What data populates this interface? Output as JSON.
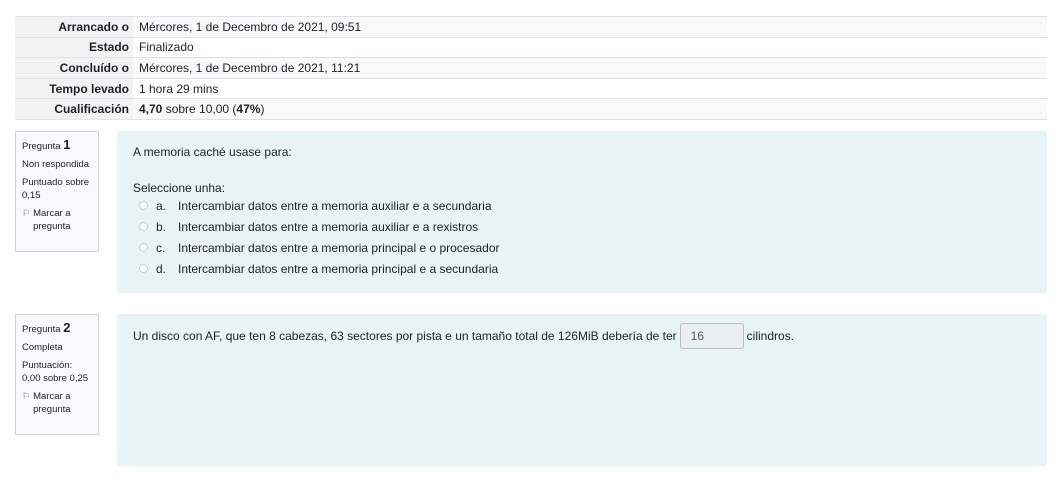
{
  "summary": {
    "rows": [
      {
        "label": "Arrancado o",
        "value": "Mércores, 1 de Decembro de 2021, 09:51"
      },
      {
        "label": "Estado",
        "value": "Finalizado"
      },
      {
        "label": "Concluído o",
        "value": "Mércores, 1 de Decembro de 2021, 11:21"
      },
      {
        "label": "Tempo levado",
        "value": "1 hora 29 mins"
      },
      {
        "label": "Cualificación",
        "grade": "4,70",
        "middle": " sobre 10,00 (",
        "percent": "47%",
        "end": ")"
      }
    ]
  },
  "q1": {
    "label": "Pregunta",
    "number": "1",
    "status": "Non respondida",
    "score": "Puntuado sobre 0,15",
    "flag_label": "Marcar a pregunta",
    "prompt": "A memoria caché usase para:",
    "select_label": "Seleccione unha:",
    "options": [
      {
        "letter": "a.",
        "text": "Intercambiar datos entre a memoria auxiliar e a secundaria"
      },
      {
        "letter": "b.",
        "text": "Intercambiar datos entre a memoria auxiliar e a rexistros"
      },
      {
        "letter": "c.",
        "text": "Intercambiar datos entre a memoria principal e o procesador"
      },
      {
        "letter": "d.",
        "text": "Intercambiar datos entre a memoria principal e a secundaria"
      }
    ]
  },
  "q2": {
    "label": "Pregunta",
    "number": "2",
    "status": "Completa",
    "score": "Puntuación: 0,00 sobre 0,25",
    "flag_label": "Marcar a pregunta",
    "text_before": "Un disco con AF, que ten 8 cabezas, 63 sectores por pista e un tamaño total de 126MiB debería de ter",
    "answer_value": "16",
    "text_after": "cilindros."
  }
}
